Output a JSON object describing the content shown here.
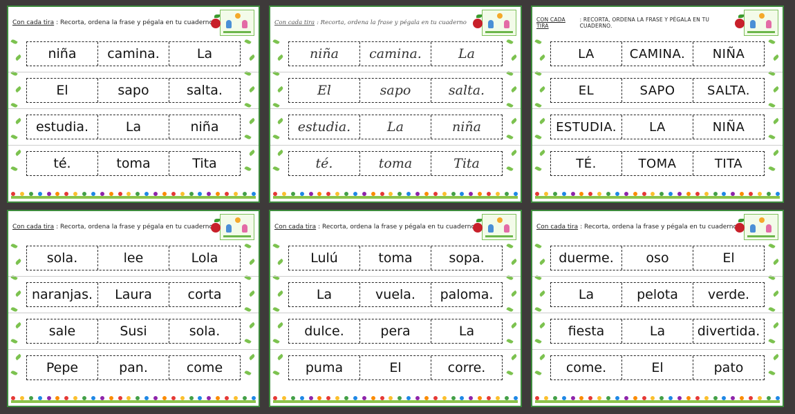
{
  "header_label": "Con cada tira",
  "header_instruction": ": Recorta, ordena la frase y pégala en tu cuaderno",
  "header_label_caps": "CON CADA TIRA",
  "header_instruction_caps": ": RECORTA, ORDENA LA FRASE Y PÉGALA EN TU CUADERNO.",
  "cards": [
    {
      "style": "print",
      "rows": [
        [
          "niña",
          "camina.",
          "La"
        ],
        [
          "El",
          "sapo",
          "salta."
        ],
        [
          "estudia.",
          "La",
          "niña"
        ],
        [
          "té.",
          "toma",
          "Tita"
        ]
      ]
    },
    {
      "style": "script",
      "rows": [
        [
          "niña",
          "camina.",
          "La"
        ],
        [
          "El",
          "sapo",
          "salta."
        ],
        [
          "estudia.",
          "La",
          "niña"
        ],
        [
          "té.",
          "toma",
          "Tita"
        ]
      ]
    },
    {
      "style": "caps",
      "rows": [
        [
          "LA",
          "CAMINA.",
          "NIÑA"
        ],
        [
          "EL",
          "SAPO",
          "SALTA."
        ],
        [
          "ESTUDIA.",
          "LA",
          "NIÑA"
        ],
        [
          "TÉ.",
          "TOMA",
          "TITA"
        ]
      ]
    },
    {
      "style": "print",
      "rows": [
        [
          "sola.",
          "lee",
          "Lola"
        ],
        [
          "naranjas.",
          "Laura",
          "corta"
        ],
        [
          "sale",
          "Susi",
          "sola."
        ],
        [
          "Pepe",
          "pan.",
          "come"
        ]
      ]
    },
    {
      "style": "print",
      "rows": [
        [
          "Lulú",
          "toma",
          "sopa."
        ],
        [
          "La",
          "vuela.",
          "paloma."
        ],
        [
          "dulce.",
          "pera",
          "La"
        ],
        [
          "puma",
          "El",
          "corre."
        ]
      ]
    },
    {
      "style": "print",
      "rows": [
        [
          "duerme.",
          "oso",
          "El"
        ],
        [
          "La",
          "pelota",
          "verde."
        ],
        [
          "fiesta",
          "La",
          "divertida."
        ],
        [
          "come.",
          "El",
          "pato"
        ]
      ]
    }
  ],
  "colors": {
    "background": "#3e3a3a",
    "card_border": "#3d8b3d",
    "leaf": "#7cc24f"
  }
}
